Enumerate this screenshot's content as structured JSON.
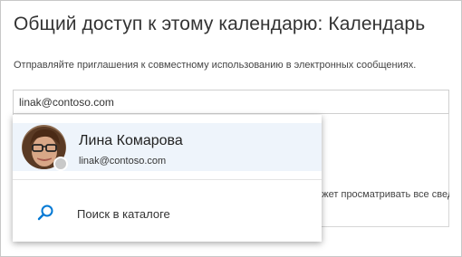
{
  "dialog": {
    "title": "Общий доступ к этому календарю: Календарь",
    "instructions": "Отправляйте приглашения к совместному использованию в электронных сообщениях."
  },
  "recipient_input": {
    "value": "linak@contoso.com"
  },
  "permission": {
    "selected": "Может просматривать все сведения"
  },
  "suggestions": {
    "person": {
      "name": "Лина Комарова",
      "email": "linak@contoso.com",
      "presence_color": "#c9c9c9"
    },
    "search_directory_label": "Поиск в каталоге",
    "search_icon": "search-icon"
  },
  "colors": {
    "accent": "#0078d4",
    "hover_row": "#eef4fb"
  }
}
